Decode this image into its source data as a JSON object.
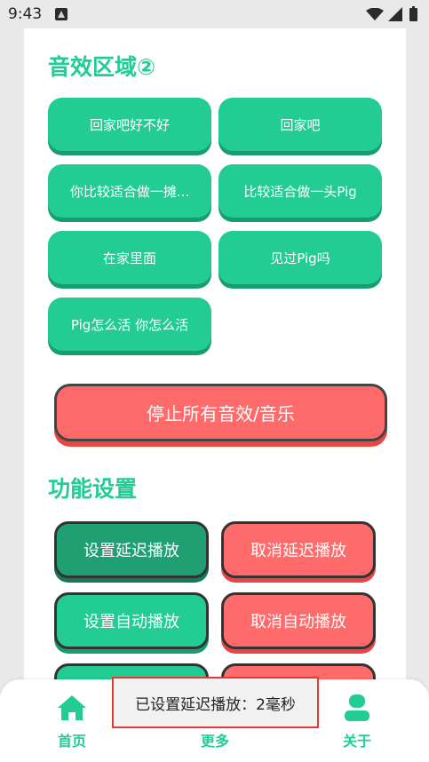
{
  "status_bar": {
    "time": "9:43",
    "icons": [
      "notification-a-icon",
      "wifi-icon",
      "signal-icon",
      "battery-icon"
    ]
  },
  "sections": {
    "sfx_title": "音效区域②",
    "function_title": "功能设置"
  },
  "sound_effects": [
    "回家吧好不好",
    "回家吧",
    "你比较适合做一摊...",
    "比较适合做一头Pig",
    "在家里面",
    "见过Pig吗",
    "Pig怎么活 你怎么活"
  ],
  "stop_button": "停止所有音效/音乐",
  "function_buttons": {
    "set_delay": "设置延迟播放",
    "cancel_delay": "取消延迟播放",
    "set_auto": "设置自动播放",
    "cancel_auto": "取消自动播放"
  },
  "bottom_nav": {
    "home": "首页",
    "more": "更多",
    "about": "关于"
  },
  "toast": "已设置延迟播放：2毫秒",
  "colors": {
    "primary_green": "#22cc92",
    "dark_green": "#1f9f72",
    "red": "#ff6b6b",
    "toast_border": "#e53935"
  }
}
